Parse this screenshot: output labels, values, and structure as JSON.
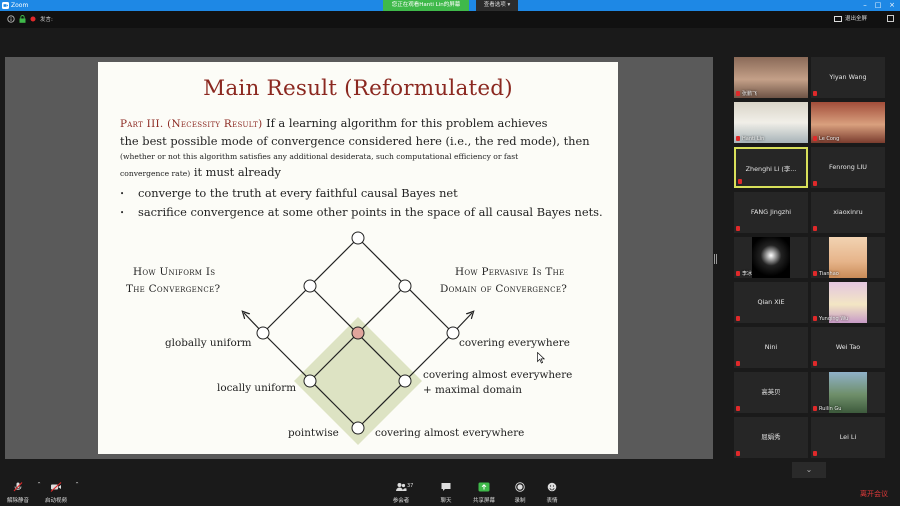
{
  "window": {
    "app_title": "Zoom",
    "share_banner": "您正在观看Hanti Lin的屏幕",
    "view_options": "查看选项",
    "view_options_chevron": "chevron-down-icon"
  },
  "meeting_bar": {
    "speaker": "发言:",
    "gallery_view": "退出全屏",
    "exit_fullscreen_icon": "exit-fullscreen-icon"
  },
  "slide": {
    "title": "Main Result (Reformulated)",
    "part_label": "Part III. (Necessity Result)",
    "line1_rest": " If a learning algorithm for this problem achieves",
    "line2": "the best possible mode of convergence considered here (i.e., the red mode), then",
    "line3": "(whether or not this algorithm satisfies any additional desiderata, such computational efficiency or fast",
    "line4_small": "convergence rate)",
    "line4_big": " it must already",
    "bullets": [
      "converge to the truth at every faithful causal Bayes net",
      "sacrifice convergence at some other points in the space of all causal Bayes nets."
    ],
    "left_question_1": "How Uniform Is",
    "left_question_2": "The Convergence?",
    "right_question_1": "How Pervasive Is The",
    "right_question_2": "Domain of Convergence?",
    "label_globally_uniform": "globally uniform",
    "label_locally_uniform": "locally uniform",
    "label_pointwise": "pointwise",
    "label_covering_everywhere": "covering everywhere",
    "label_covering_almost_max_1": "covering almost everywhere",
    "label_covering_almost_max_2": "+ maximal domain",
    "label_covering_almost": "covering almost everywhere",
    "colors": {
      "title": "#8b2820",
      "highlight": "#dde3c3",
      "red_node": "#e0a59c"
    }
  },
  "participants": [
    {
      "name": "张鹏飞",
      "video": true
    },
    {
      "name": "Yiyan Wang",
      "video": false
    },
    {
      "name": "Hanti Lin",
      "video": true
    },
    {
      "name": "Le Cong",
      "video": true
    },
    {
      "name": "Zhenghi Li (李...",
      "video": false,
      "active": true
    },
    {
      "name": "Fenrong LIU",
      "video": false
    },
    {
      "name": "FANG Jingzhi",
      "video": false
    },
    {
      "name": "xiaoxinru",
      "video": false
    },
    {
      "name": "李冰",
      "video": true
    },
    {
      "name": "Tianhao",
      "video": true
    },
    {
      "name": "Qian XIE",
      "video": false
    },
    {
      "name": "Yunqing Wu",
      "video": true
    },
    {
      "name": "Nini",
      "video": false
    },
    {
      "name": "Wei Tao",
      "video": false
    },
    {
      "name": "高英贝",
      "video": false
    },
    {
      "name": "Ruilin Gu",
      "video": true
    },
    {
      "name": "屈娟秀",
      "video": false
    },
    {
      "name": "Lei Li",
      "video": false
    }
  ],
  "toolbar": {
    "unmute": "解除静音",
    "start_video": "启动视频",
    "participants": "参会者",
    "participants_count": "37",
    "chat": "聊天",
    "share_screen": "共享屏幕",
    "record": "录制",
    "reactions": "表情",
    "leave": "离开会议"
  }
}
